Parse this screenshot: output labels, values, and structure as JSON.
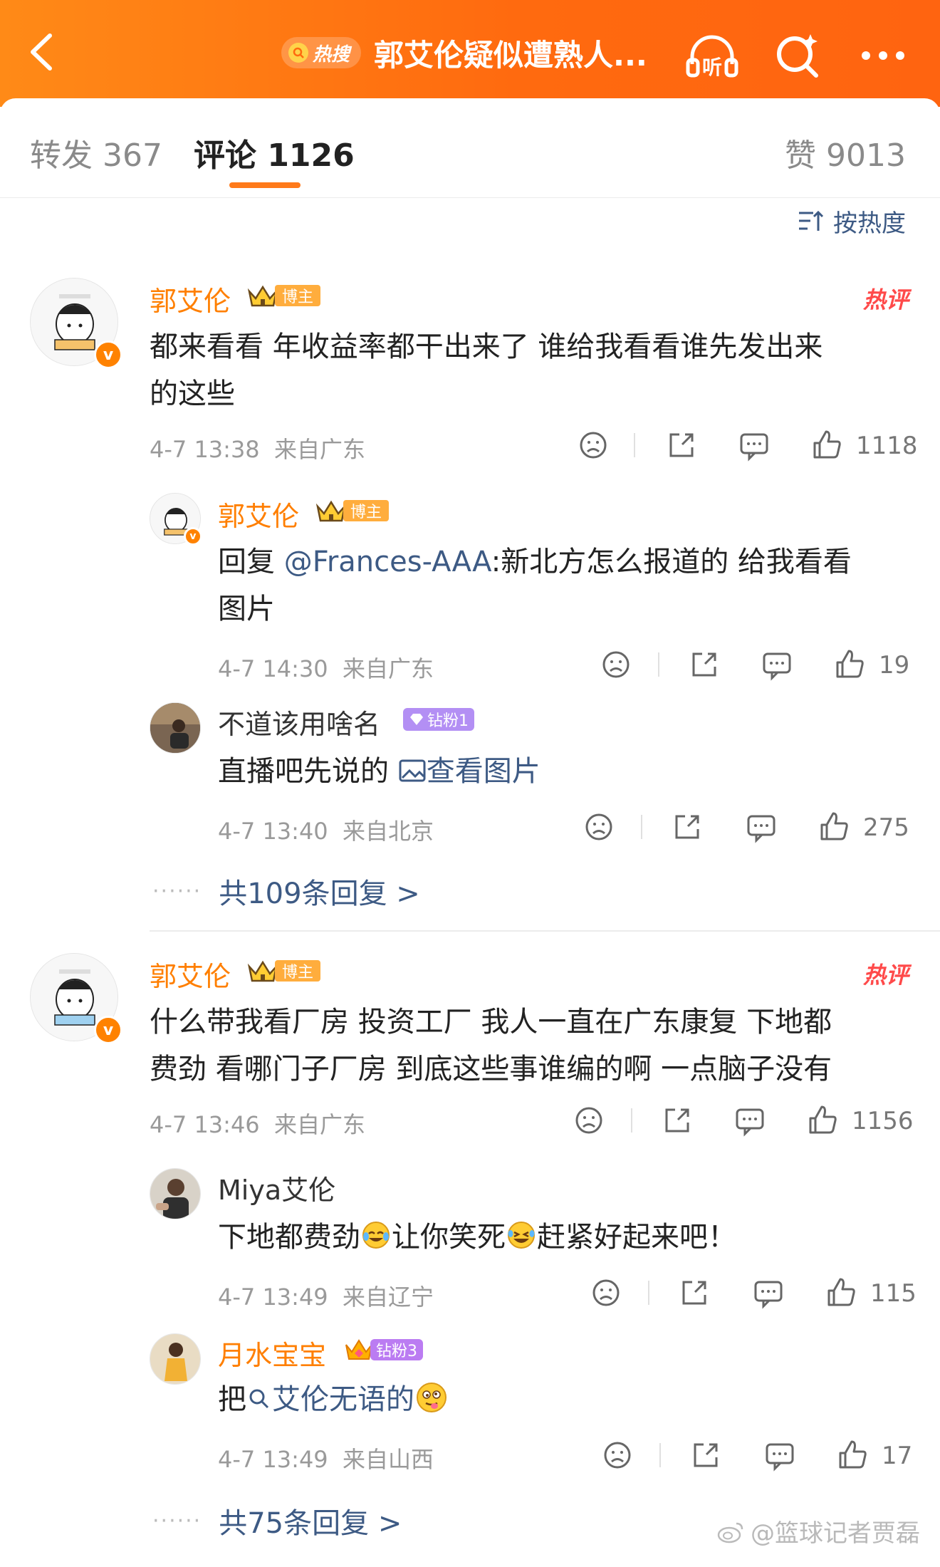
{
  "header": {
    "hot_label": "热搜",
    "title": "郭艾伦疑似遭熟人...",
    "listen_label": "听"
  },
  "tabs": {
    "repost": "转发 367",
    "comments": "评论 1126",
    "likes": "赞 9013"
  },
  "sort": {
    "label": "按热度"
  },
  "comments": [
    {
      "user": "郭艾伦",
      "badge": "博主",
      "hot": "热评",
      "text_line1": "都来看看 年收益率都干出来了 谁给我看看谁先发出来",
      "text_line2": "的这些",
      "time": "4-7 13:38",
      "location": "来自广东",
      "likes": "1118",
      "replies": [
        {
          "user": "郭艾伦",
          "badge": "博主",
          "prefix": "回复 ",
          "mention": "@Frances-AAA",
          "text_line1": ":新北方怎么报道的 给我看看",
          "text_line2": "图片",
          "time": "4-7 14:30",
          "location": "来自广东",
          "likes": "19"
        },
        {
          "user": "不道该用啥名",
          "badge": "钻粉1",
          "text": "直播吧先说的 ",
          "link": "查看图片",
          "time": "4-7 13:40",
          "location": "来自北京",
          "likes": "275"
        }
      ],
      "more_replies": "共109条回复 >"
    },
    {
      "user": "郭艾伦",
      "badge": "博主",
      "hot": "热评",
      "text_line1": "什么带我看厂房 投资工厂 我人一直在广东康复 下地都",
      "text_line2": "费劲 看哪门子厂房 到底这些事谁编的啊 一点脑子没有",
      "time": "4-7 13:46",
      "location": "来自广东",
      "likes": "1156",
      "replies": [
        {
          "user": "Miya艾伦",
          "text_a": "下地都费劲",
          "text_b": "让你笑死",
          "text_c": "赶紧好起来吧！",
          "time": "4-7 13:49",
          "location": "来自辽宁",
          "likes": "115"
        },
        {
          "user": "月水宝宝",
          "badge": "钻粉3",
          "text_a": "把",
          "link": "艾伦无语的",
          "time": "4-7 13:49",
          "location": "来自山西",
          "likes": "17"
        }
      ],
      "more_replies": "共75条回复 >"
    }
  ],
  "watermark": "@篮球记者贾磊",
  "colors": {
    "header_orange": "#ff7a12",
    "username_orange": "#ff7f00",
    "link_blue": "#3d5a84",
    "hot_red": "#ff4a4a"
  }
}
